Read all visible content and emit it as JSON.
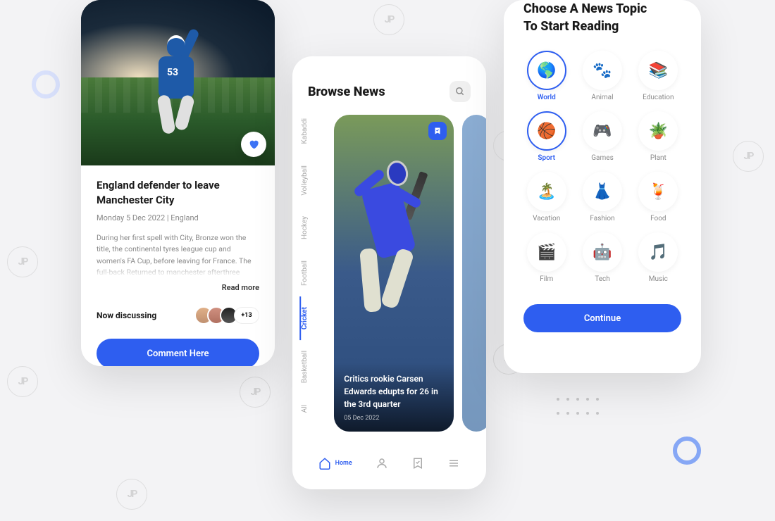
{
  "article_screen": {
    "title": "England defender to leave Manchester City",
    "meta": "Monday 5 Dec 2022 | England",
    "body": "During her first spell with City, Bronze won the title, the continental tyres league cup and women's FA Cup, before leaving for France. The full-back Returned to manchester afterthree seasons with lyon and was later crowned",
    "read_more": "Read more",
    "discussing_label": "Now discussing",
    "extra_count": "+13",
    "cta": "Comment Here",
    "player_number": "53"
  },
  "browse_screen": {
    "title": "Browse News",
    "vtabs": [
      "All",
      "Basketball",
      "Cricket",
      "Football",
      "Hockey",
      "Volleyball",
      "Kabaddi"
    ],
    "active_vtab": "Cricket",
    "card": {
      "headline": "Critics rookie Carsen Edwards edupts for 26 in the 3rd quarter",
      "date": "05 Dec 2022"
    },
    "nav": {
      "home": "Home"
    }
  },
  "topics_screen": {
    "title_line1": "Choose A News Topic",
    "title_line2": "To Start Reading",
    "topics": [
      {
        "label": "World",
        "icon": "🌎",
        "selected": true
      },
      {
        "label": "Animal",
        "icon": "🐾",
        "selected": false
      },
      {
        "label": "Education",
        "icon": "📚",
        "selected": false
      },
      {
        "label": "Sport",
        "icon": "🏀",
        "selected": true
      },
      {
        "label": "Games",
        "icon": "🎮",
        "selected": false
      },
      {
        "label": "Plant",
        "icon": "🪴",
        "selected": false
      },
      {
        "label": "Vacation",
        "icon": "🏝️",
        "selected": false
      },
      {
        "label": "Fashion",
        "icon": "👗",
        "selected": false
      },
      {
        "label": "Food",
        "icon": "🍹",
        "selected": false
      },
      {
        "label": "Film",
        "icon": "🎬",
        "selected": false
      },
      {
        "label": "Tech",
        "icon": "🤖",
        "selected": false
      },
      {
        "label": "Music",
        "icon": "🎵",
        "selected": false
      }
    ],
    "cta": "Continue"
  }
}
